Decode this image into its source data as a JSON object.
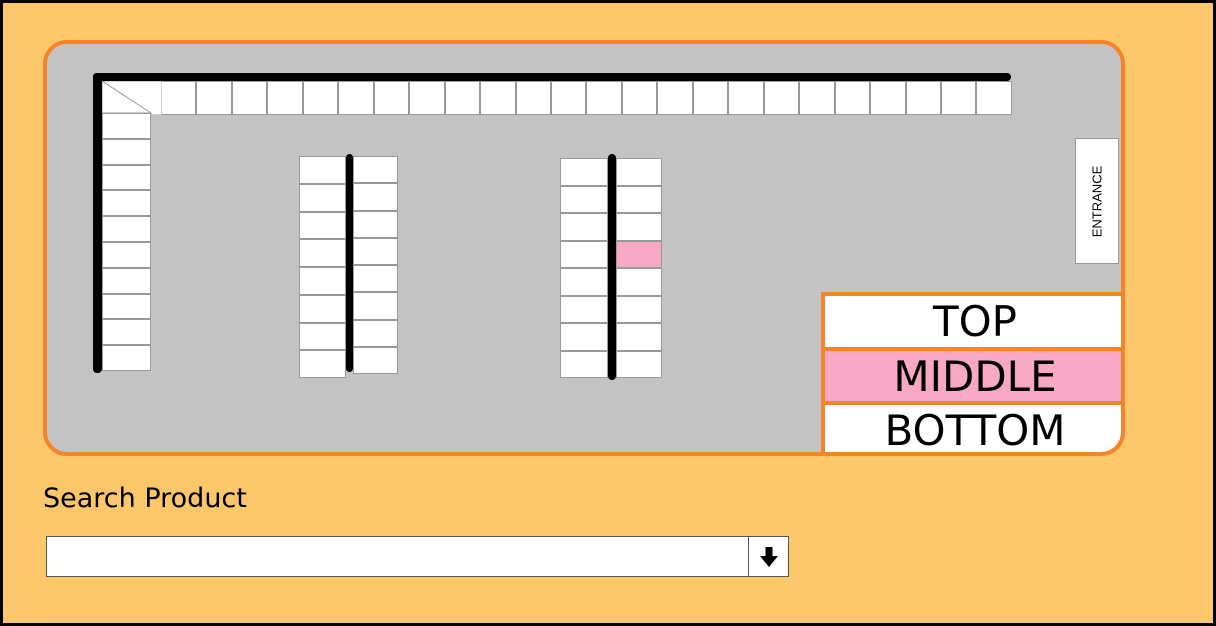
{
  "store_map": {
    "entrance_label": "ENTRANCE",
    "highlighted_shelf": {
      "aisle": 2,
      "side": "right",
      "position": 4
    },
    "aisles": [
      {
        "name": "top-shelf",
        "cells": 24
      },
      {
        "name": "left-wall-shelf",
        "cells": 10
      },
      {
        "name": "aisle-1-left",
        "cells": 8
      },
      {
        "name": "aisle-1-right",
        "cells": 8
      },
      {
        "name": "aisle-2-left",
        "cells": 8
      },
      {
        "name": "aisle-2-right",
        "cells": 8
      }
    ]
  },
  "legend": {
    "top_label": "TOP",
    "middle_label": "MIDDLE",
    "bottom_label": "BOTTOM"
  },
  "search": {
    "label": "Search Product",
    "value": "",
    "dropdown_icon": "down-arrow-icon"
  },
  "colors": {
    "background": "#FCC66B",
    "border_accent": "#F58427",
    "map_floor": "#C3C3C3",
    "highlight": "#F7A8C4"
  }
}
